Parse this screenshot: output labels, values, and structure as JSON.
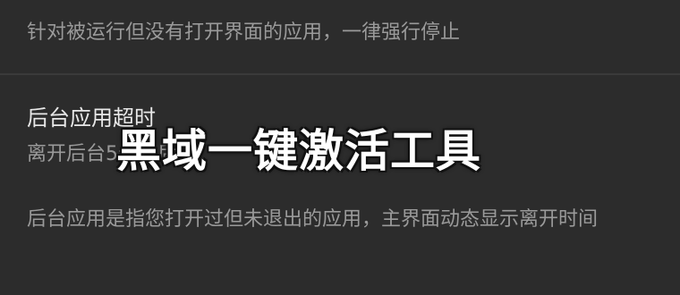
{
  "top_setting": {
    "description": "针对被运行但没有打开界面的应用，一律强行停止"
  },
  "background_timeout": {
    "title": "后台应用超时",
    "value": "离开后台5分钟后",
    "description": "后台应用是指您打开过但未退出的应用，主界面动态显示离开时间"
  },
  "overlay": {
    "watermark": "黑域一键激活工具"
  }
}
